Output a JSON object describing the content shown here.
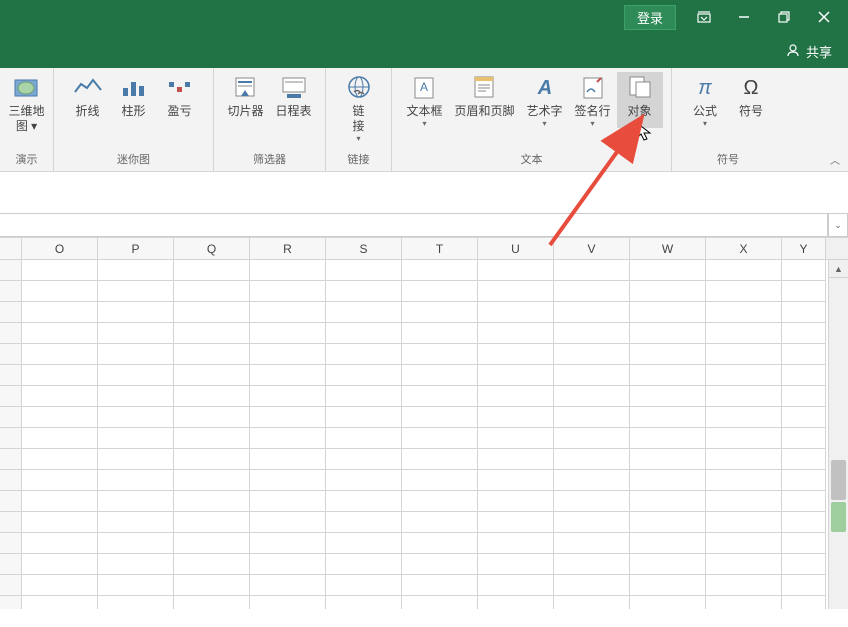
{
  "titlebar": {
    "login": "登录"
  },
  "subbar": {
    "share": "共享"
  },
  "ribbon": {
    "groups": [
      {
        "label": "演示",
        "buttons": [
          {
            "name": "3d-map",
            "label": "三维地\n图 ▾",
            "has_dropdown": false
          }
        ]
      },
      {
        "label": "迷你图",
        "buttons": [
          {
            "name": "sparkline-line",
            "label": "折线"
          },
          {
            "name": "sparkline-column",
            "label": "柱形"
          },
          {
            "name": "sparkline-winloss",
            "label": "盈亏"
          }
        ]
      },
      {
        "label": "筛选器",
        "buttons": [
          {
            "name": "slicer",
            "label": "切片器"
          },
          {
            "name": "timeline",
            "label": "日程表"
          }
        ]
      },
      {
        "label": "链接",
        "buttons": [
          {
            "name": "hyperlink",
            "label": "链\n接",
            "has_dropdown": true
          }
        ]
      },
      {
        "label": "文本",
        "buttons": [
          {
            "name": "textbox",
            "label": "文本框",
            "has_dropdown": true
          },
          {
            "name": "header-footer",
            "label": "页眉和页脚"
          },
          {
            "name": "wordart",
            "label": "艺术字",
            "has_dropdown": true
          },
          {
            "name": "signature",
            "label": "签名行",
            "has_dropdown": true
          },
          {
            "name": "object",
            "label": "对象",
            "highlighted": true
          }
        ]
      },
      {
        "label": "符号",
        "buttons": [
          {
            "name": "equation",
            "label": "公式",
            "has_dropdown": true
          },
          {
            "name": "symbol",
            "label": "符号"
          }
        ]
      }
    ]
  },
  "columns": [
    "O",
    "P",
    "Q",
    "R",
    "S",
    "T",
    "U",
    "V",
    "W",
    "X",
    "Y"
  ]
}
